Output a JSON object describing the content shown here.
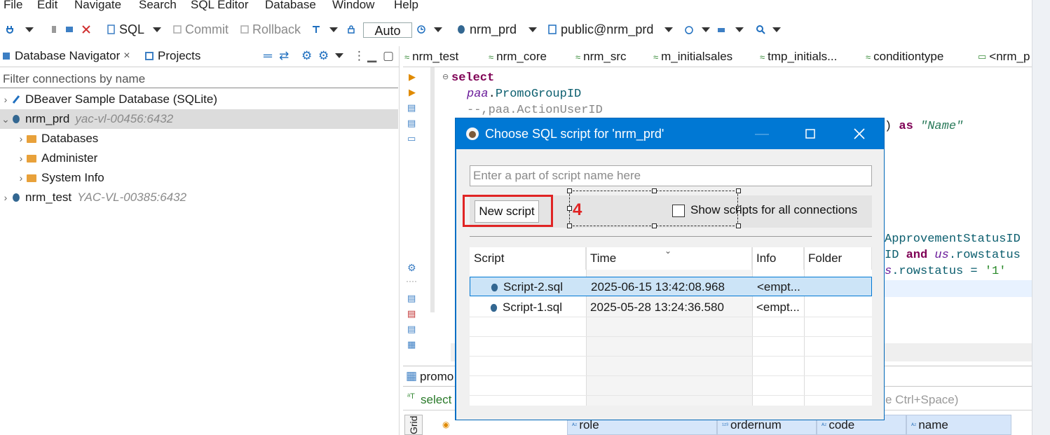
{
  "menu": [
    "File",
    "Edit",
    "Navigate",
    "Search",
    "SQL Editor",
    "Database",
    "Window",
    "Help"
  ],
  "toolbar": {
    "sql_label": "SQL",
    "commit_label": "Commit",
    "rollback_label": "Rollback",
    "transaction_mode": "Auto",
    "connection": "nrm_prd",
    "schema": "public@nrm_prd"
  },
  "navigator": {
    "tab_label": "Database Navigator",
    "projects_tab": "Projects",
    "filter_placeholder": "Filter connections by name",
    "tree": [
      {
        "label": "DBeaver Sample Database (SQLite)",
        "host": ""
      },
      {
        "label": "nrm_prd",
        "host": "yac-vl-00456:6432"
      },
      {
        "label": "Databases",
        "host": ""
      },
      {
        "label": "Administer",
        "host": ""
      },
      {
        "label": "System Info",
        "host": ""
      },
      {
        "label": "nrm_test",
        "host": "YAC-VL-00385:6432"
      }
    ]
  },
  "editor": {
    "tabs": [
      "nrm_test",
      "nrm_core",
      "nrm_src",
      "m_initialsales",
      "tmp_initials...",
      "conditiontype",
      "<nrm_p"
    ],
    "code": {
      "l1": "select",
      "l2_alias": "paa",
      "l2_col": "PromoGroupID",
      "l3": "--,paa.ActionUserID",
      "l4_as": "as",
      "l4_name": "\"Name\"",
      "l5": "ApprovementStatusID",
      "l6_a": "ID",
      "l6_and": "and",
      "l6_us": "us",
      "l6_col": ".rowstatus",
      "l7_s": "s",
      "l7_col": ".rowstatus = ",
      "l7_val": "'1'"
    }
  },
  "results": {
    "tab_label": "promo",
    "filter_text": "select",
    "filter_hint": "e Ctrl+Space)",
    "grid_label": "Grid",
    "columns": [
      "role",
      "ordernum",
      "code",
      "name"
    ]
  },
  "dialog": {
    "title": "Choose SQL script for 'nrm_prd'",
    "search_placeholder": "Enter a part of script name here",
    "new_script_label": "New script",
    "step_number": "4",
    "show_all_label": "Show scripts for all connections",
    "columns": [
      "Script",
      "Time",
      "Info",
      "Folder"
    ],
    "rows": [
      {
        "script": "Script-2.sql",
        "time": "2025-06-15 13:42:08.968",
        "info": "<empt...",
        "folder": ""
      },
      {
        "script": "Script-1.sql",
        "time": "2025-05-28 13:24:36.580",
        "info": "<empt...",
        "folder": ""
      }
    ]
  }
}
